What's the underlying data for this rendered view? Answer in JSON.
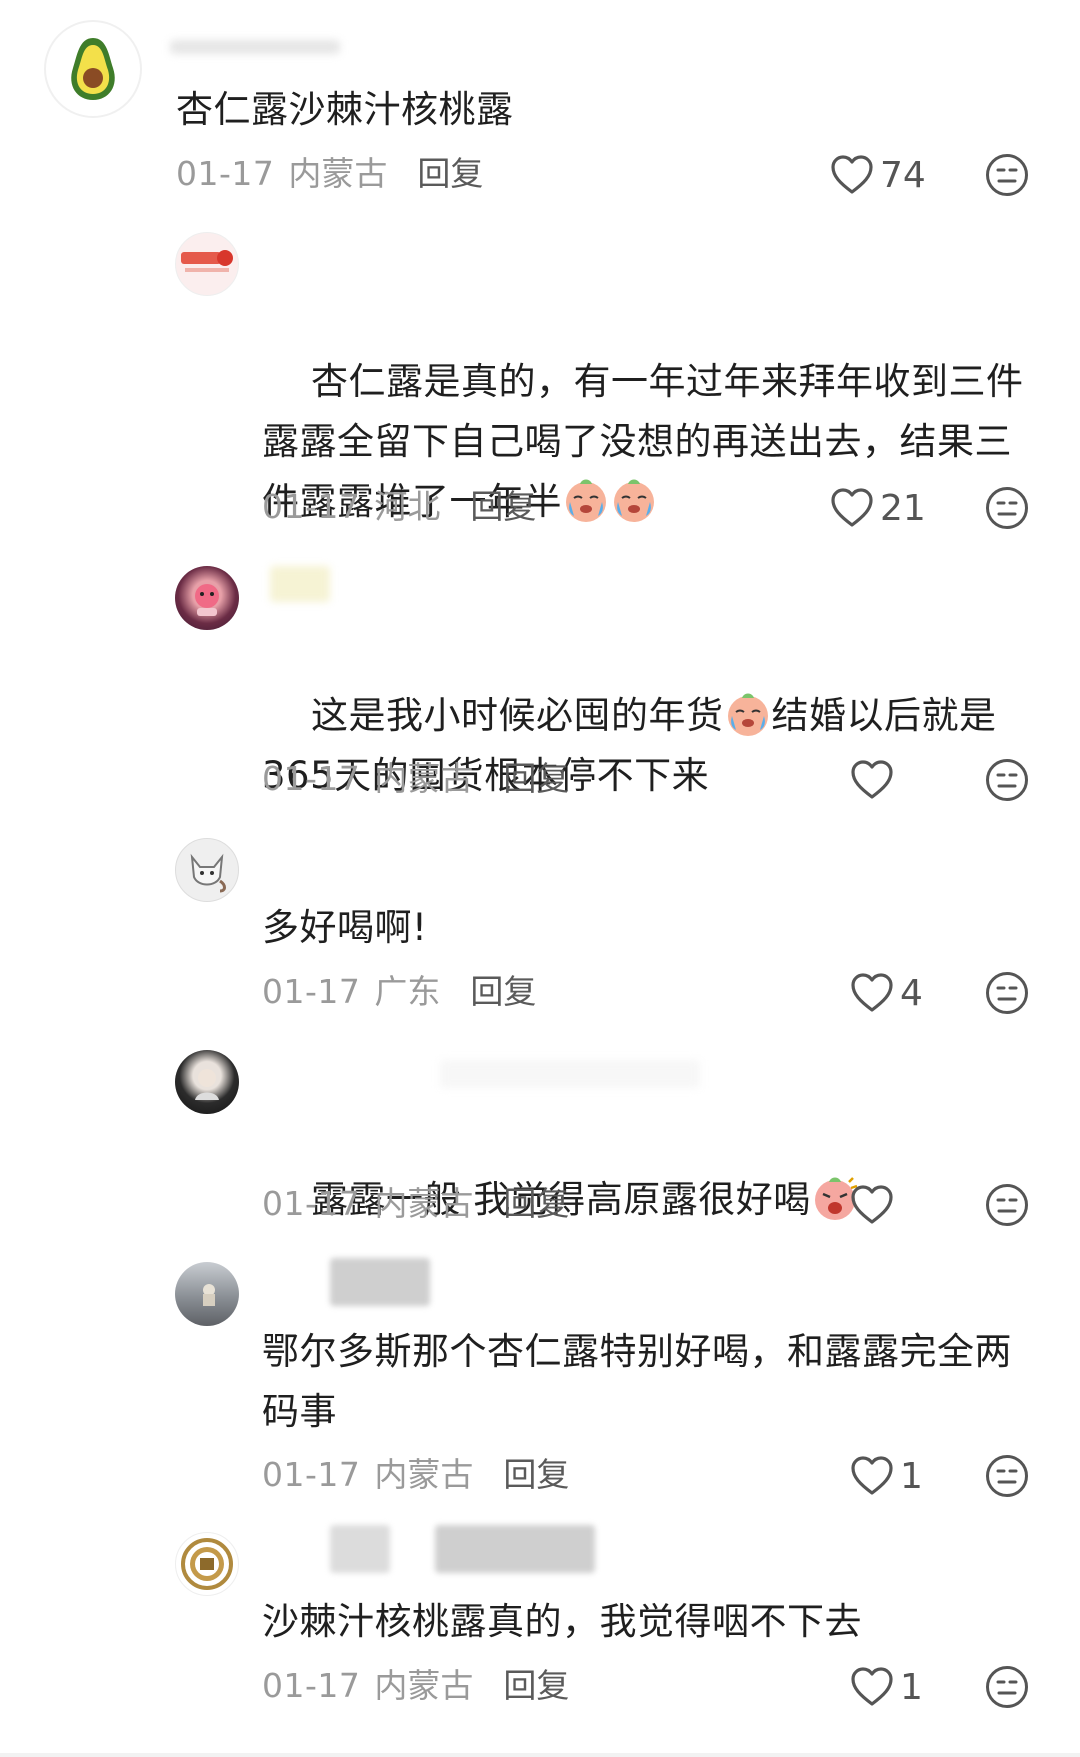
{
  "comments": [
    {
      "text": "杏仁露沙棘汁核桃露",
      "date": "01-17",
      "location": "内蒙古",
      "reply": "回复",
      "likes": "74"
    },
    {
      "text_parts": [
        "杏仁露是真的，有一年过年来拜年收到三件露露全留下自己喝了没想的再送出去，结果三件露露堆了一年半",
        "",
        ""
      ],
      "date": "01-17",
      "location": "河北",
      "reply": "回复",
      "likes": "21"
    },
    {
      "text_parts": [
        "这是我小时候必囤的年货",
        "结婚以后就是 365天的囤货根本停不下来"
      ],
      "date": "01-17",
      "location": "内蒙古",
      "reply": "回复",
      "likes": ""
    },
    {
      "text": "多好喝啊!",
      "date": "01-17",
      "location": "广东",
      "reply": "回复",
      "likes": "4"
    },
    {
      "text_parts": [
        "露露一般 我觉得高原露很好喝",
        ""
      ],
      "date": "01-17",
      "location": "内蒙古",
      "reply": "回复",
      "likes": ""
    },
    {
      "text": "鄂尔多斯那个杏仁露特别好喝，和露露完全两码事",
      "date": "01-17",
      "location": "内蒙古",
      "reply": "回复",
      "likes": "1"
    },
    {
      "text": "沙棘汁核桃露真的，我觉得咽不下去",
      "date": "01-17",
      "location": "内蒙古",
      "reply": "回复",
      "likes": "1"
    }
  ],
  "icons": {
    "like": "heart-outline-icon",
    "dislike": "neutral-face-icon",
    "emoji_cry": "crying-face-emoji",
    "emoji_angry": "shouting-face-emoji"
  },
  "colors": {
    "meta": "#9a9a9a",
    "icon": "#555555"
  }
}
